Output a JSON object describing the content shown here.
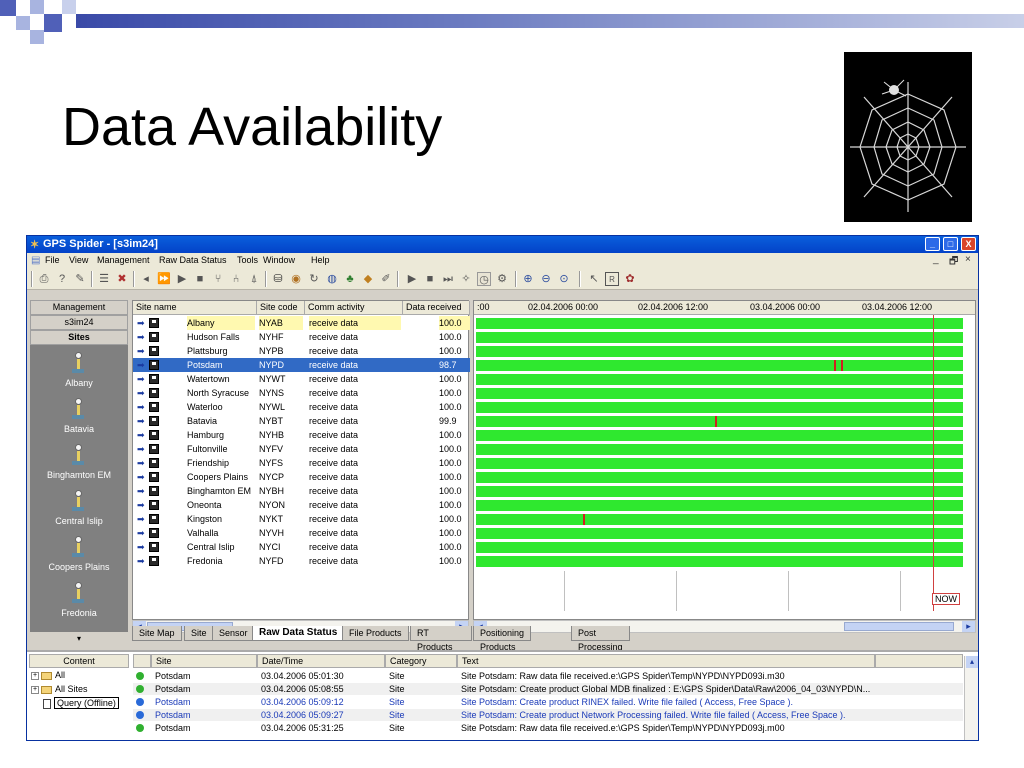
{
  "slide": {
    "title": "Data Availability"
  },
  "window": {
    "title": "GPS Spider - [s3im24]",
    "controls": {
      "minimize": "_",
      "maximize": "□",
      "close": "X"
    },
    "mdi_controls": {
      "minimize": "_",
      "restore": "🗗",
      "close": "×"
    }
  },
  "menu": {
    "items": [
      {
        "label": "File"
      },
      {
        "label": "View"
      },
      {
        "label": "Management"
      },
      {
        "label": "Raw Data Status"
      },
      {
        "label": "Tools"
      },
      {
        "label": "Window"
      },
      {
        "label": "Help"
      }
    ]
  },
  "toolbar": {
    "icons": [
      "print-icon",
      "help-icon",
      "tools-icon",
      "list-icon",
      "close-icon",
      "back-icon",
      "fast-forward-icon",
      "play-icon",
      "stop-icon",
      "fork-icon",
      "merge-icon",
      "antenna-icon",
      "database-icon",
      "sphere-icon",
      "refresh-icon",
      "globe-icon",
      "tree-icon",
      "bucket-icon",
      "pencil-icon",
      "play2-icon",
      "stop2-icon",
      "skip-icon",
      "wand-icon",
      "clock-icon",
      "gear-icon",
      "zoom-in-icon",
      "zoom-out-icon",
      "zoom-fit-icon",
      "pointer-icon",
      "report-icon",
      "settings-icon"
    ]
  },
  "sidebar": {
    "header": "Management",
    "server": "s3im24",
    "section": "Sites",
    "sites": [
      {
        "label": "Albany"
      },
      {
        "label": "Batavia"
      },
      {
        "label": "Binghamton EM"
      },
      {
        "label": "Central Islip"
      },
      {
        "label": "Coopers Plains"
      },
      {
        "label": "Fredonia"
      }
    ]
  },
  "site_table": {
    "columns": [
      "Site name",
      "Site code",
      "Comm activity",
      "Data received"
    ],
    "rows": [
      {
        "name": "Albany",
        "code": "NYAB",
        "comm": "receive data",
        "data": "100.0"
      },
      {
        "name": "Hudson Falls",
        "code": "NYHF",
        "comm": "receive data",
        "data": "100.0"
      },
      {
        "name": "Plattsburg",
        "code": "NYPB",
        "comm": "receive data",
        "data": "100.0"
      },
      {
        "name": "Potsdam",
        "code": "NYPD",
        "comm": "receive data",
        "data": "98.7"
      },
      {
        "name": "Watertown",
        "code": "NYWT",
        "comm": "receive data",
        "data": "100.0"
      },
      {
        "name": "North Syracuse",
        "code": "NYNS",
        "comm": "receive data",
        "data": "100.0"
      },
      {
        "name": "Waterloo",
        "code": "NYWL",
        "comm": "receive data",
        "data": "100.0"
      },
      {
        "name": "Batavia",
        "code": "NYBT",
        "comm": "receive data",
        "data": "99.9"
      },
      {
        "name": "Hamburg",
        "code": "NYHB",
        "comm": "receive data",
        "data": "100.0"
      },
      {
        "name": "Fultonville",
        "code": "NYFV",
        "comm": "receive data",
        "data": "100.0"
      },
      {
        "name": "Friendship",
        "code": "NYFS",
        "comm": "receive data",
        "data": "100.0"
      },
      {
        "name": "Coopers Plains",
        "code": "NYCP",
        "comm": "receive data",
        "data": "100.0"
      },
      {
        "name": "Binghamton EM",
        "code": "NYBH",
        "comm": "receive data",
        "data": "100.0"
      },
      {
        "name": "Oneonta",
        "code": "NYON",
        "comm": "receive data",
        "data": "100.0"
      },
      {
        "name": "Kingston",
        "code": "NYKT",
        "comm": "receive data",
        "data": "100.0"
      },
      {
        "name": "Valhalla",
        "code": "NYVH",
        "comm": "receive data",
        "data": "100.0"
      },
      {
        "name": "Central Islip",
        "code": "NYCI",
        "comm": "receive data",
        "data": "100.0"
      },
      {
        "name": "Fredonia",
        "code": "NYFD",
        "comm": "receive data",
        "data": "100.0"
      }
    ],
    "highlighted_row": 0,
    "selected_row": 3
  },
  "timeline": {
    "ticks": [
      ":00",
      "02.04.2006 00:00",
      "02.04.2006 12:00",
      "03.04.2006 00:00",
      "03.04.2006 12:00"
    ],
    "now_label": "NOW",
    "gaps": [
      {
        "row": 3,
        "position": 0.735
      },
      {
        "row": 3,
        "position": 0.75
      },
      {
        "row": 7,
        "position": 0.49
      },
      {
        "row": 14,
        "position": 0.22
      }
    ]
  },
  "tabs_left": [
    {
      "label": "Site Map"
    },
    {
      "label": "Site"
    },
    {
      "label": "Sensor"
    },
    {
      "label": "Raw Data Status"
    },
    {
      "label": "File Products"
    },
    {
      "label": "RT Products"
    }
  ],
  "tabs_right": [
    {
      "label": "Positioning Products"
    },
    {
      "label": "Post Processing"
    }
  ],
  "log": {
    "content_header": "Content",
    "tree": [
      {
        "label": "All"
      },
      {
        "label": "All Sites"
      },
      {
        "label": "Query (Offline)"
      }
    ],
    "columns": [
      "Site",
      "Date/Time",
      "Category",
      "Text"
    ],
    "rows": [
      {
        "site": "Potsdam",
        "time": "03.04.2006 05:01:30",
        "category": "Site",
        "text": "Site Potsdam: Raw data file received.e:\\GPS Spider\\Temp\\NYPD\\NYPD093i.m30",
        "status": "ok"
      },
      {
        "site": "Potsdam",
        "time": "03.04.2006 05:08:55",
        "category": "Site",
        "text": "Site Potsdam: Create product Global MDB finalized : E:\\GPS Spider\\Data\\Raw\\2006_04_03\\NYPD\\N...",
        "status": "ok"
      },
      {
        "site": "Potsdam",
        "time": "03.04.2006 05:09:12",
        "category": "Site",
        "text": "Site Potsdam: Create product RINEX failed. Write file failed ( Access, Free Space ).",
        "status": "error"
      },
      {
        "site": "Potsdam",
        "time": "03.04.2006 05:09:27",
        "category": "Site",
        "text": "Site Potsdam: Create product Network Processing failed. Write file failed ( Access, Free Space ).",
        "status": "error"
      },
      {
        "site": "Potsdam",
        "time": "03.04.2006 05:31:25",
        "category": "Site",
        "text": "Site Potsdam: Raw data file received.e:\\GPS Spider\\Temp\\NYPD\\NYPD093j.m00",
        "status": "ok"
      }
    ]
  },
  "colors": {
    "accent": "#316ac5",
    "data_bar": "#2fe82f",
    "gap": "#d02020",
    "error_text": "#1a3ab8",
    "deco_blue": "#5060b8",
    "deco_light": "#a8b4e0"
  }
}
